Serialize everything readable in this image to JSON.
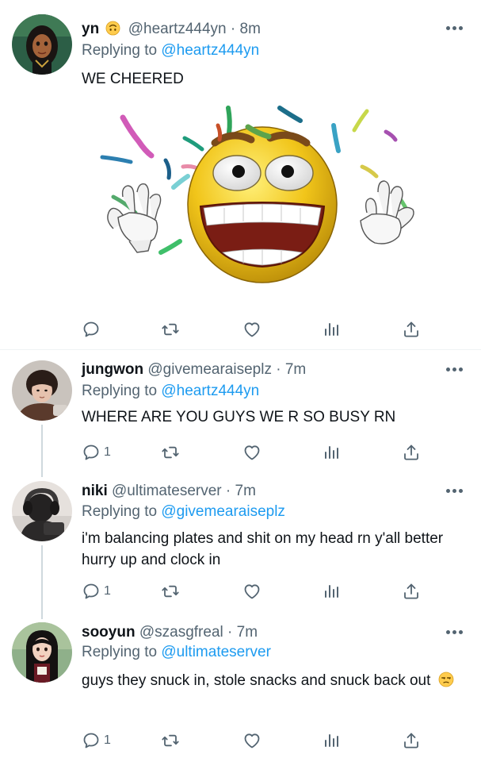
{
  "colors": {
    "link": "#1d9bf0",
    "secondary_text": "#536471",
    "primary_text": "#0f1419",
    "divider": "#eff3f4",
    "thread_line": "#cfd9de"
  },
  "tweets": [
    {
      "name": "yn",
      "name_emoji": "upside-down-face",
      "handle": "@heartz444yn",
      "separator": "·",
      "time": "8m",
      "replying_prefix": "Replying to",
      "replying_to": "@heartz444yn",
      "text": "WE CHEERED",
      "media": "cheering-emoji-image",
      "reply_count": ""
    },
    {
      "name": "jungwon",
      "handle": "@givemearaiseplz",
      "separator": "·",
      "time": "7m",
      "replying_prefix": "Replying to",
      "replying_to": "@heartz444yn",
      "text": "WHERE ARE YOU GUYS WE R SO BUSY RN",
      "reply_count": "1"
    },
    {
      "name": "niki",
      "handle": "@ultimateserver",
      "separator": "·",
      "time": "7m",
      "replying_prefix": "Replying to",
      "replying_to": "@givemearaiseplz",
      "text": "i'm balancing plates and shit on my head rn y'all better hurry up and clock in",
      "reply_count": "1"
    },
    {
      "name": "sooyun",
      "handle": "@szasgfreal",
      "separator": "·",
      "time": "7m",
      "replying_prefix": "Replying to",
      "replying_to": "@ultimateserver",
      "text": "guys they snuck in, stole snacks and snuck back out",
      "text_emoji": "unamused-face",
      "reply_count": "1"
    }
  ],
  "icons": {
    "reply": "reply-icon",
    "retweet": "retweet-icon",
    "like": "heart-icon",
    "views": "views-icon",
    "share": "share-icon",
    "more": "more-options-icon"
  }
}
